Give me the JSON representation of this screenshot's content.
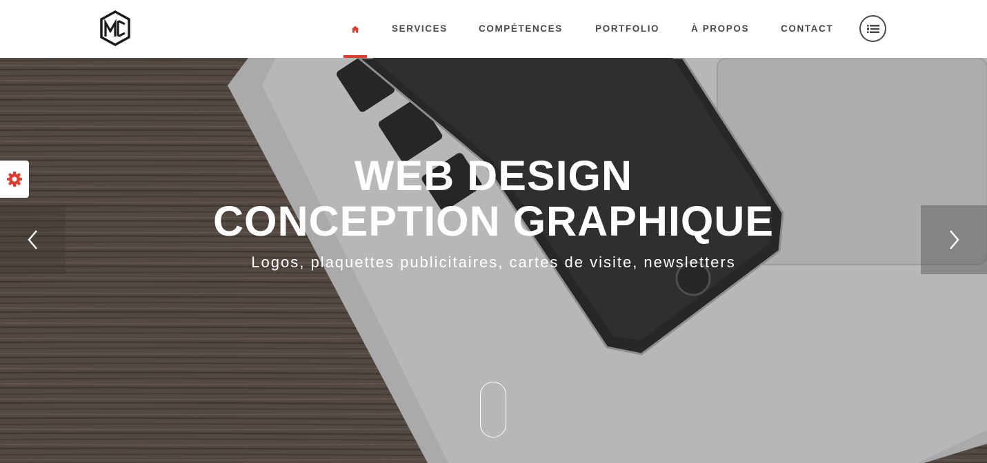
{
  "brand": {
    "logo_text": "MC",
    "logo_icon": "mc-hexagon-logo"
  },
  "nav": {
    "home_icon": "home-icon",
    "items": [
      {
        "label": "SERVICES"
      },
      {
        "label": "COMPÉTENCES"
      },
      {
        "label": "PORTFOLIO"
      },
      {
        "label": "À PROPOS"
      },
      {
        "label": "CONTACT"
      }
    ],
    "menu_icon": "menu-list-icon",
    "active_color": "#e53a2f"
  },
  "hero": {
    "title_line1": "WEB DESIGN",
    "title_line2": "CONCEPTION GRAPHIQUE",
    "subtitle": "Logos, plaquettes publicitaires, cartes de visite, newsletters",
    "prev_icon": "chevron-left-icon",
    "next_icon": "chevron-right-icon",
    "scroll_icon": "mouse-scroll-icon"
  },
  "settings": {
    "icon": "gear-icon",
    "color": "#e53a2f"
  }
}
